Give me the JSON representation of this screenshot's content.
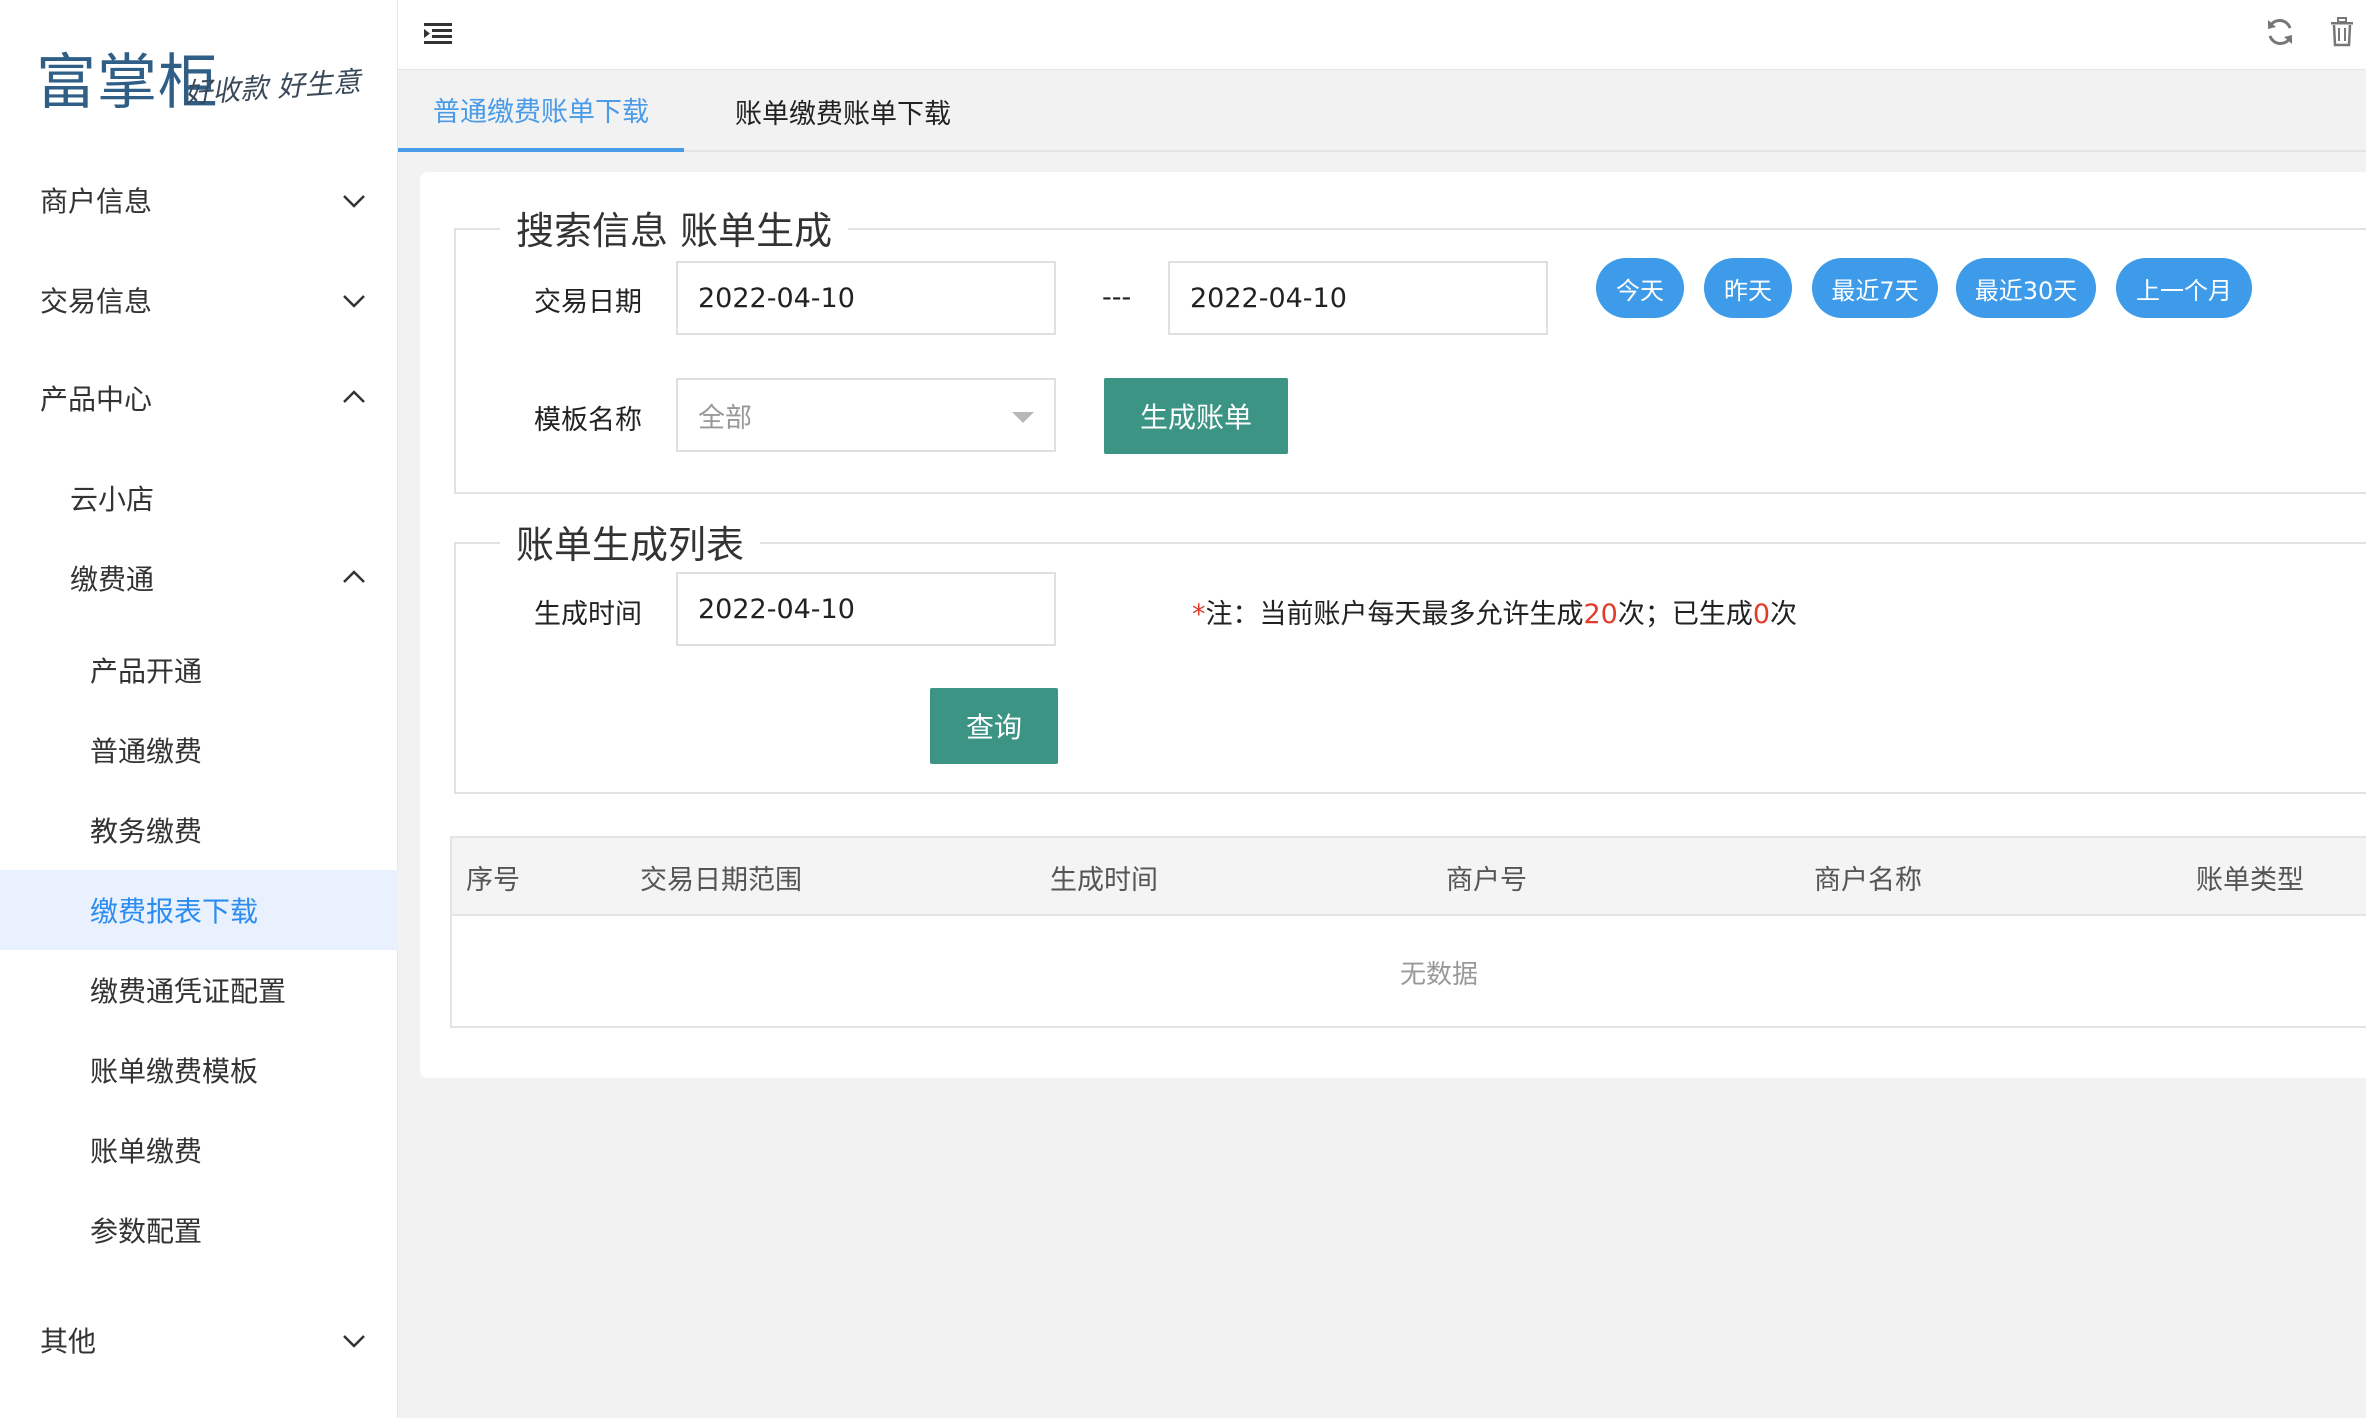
{
  "brand": {
    "name": "富掌柜",
    "slogan": "好收款 好生意"
  },
  "sidebar": {
    "items": [
      {
        "label": "商户信息"
      },
      {
        "label": "交易信息"
      },
      {
        "label": "产品中心"
      },
      {
        "label": "云小店"
      },
      {
        "label": "缴费通"
      },
      {
        "label": "产品开通"
      },
      {
        "label": "普通缴费"
      },
      {
        "label": "教务缴费"
      },
      {
        "label": "缴费报表下载"
      },
      {
        "label": "缴费通凭证配置"
      },
      {
        "label": "账单缴费模板"
      },
      {
        "label": "账单缴费"
      },
      {
        "label": "参数配置"
      },
      {
        "label": "其他"
      }
    ]
  },
  "tabs": [
    {
      "label": "普通缴费账单下载"
    },
    {
      "label": "账单缴费账单下载"
    }
  ],
  "search_section": {
    "legend": "搜索信息 账单生成",
    "trade_date_label": "交易日期",
    "date_start": "2022-04-10",
    "date_separator": "---",
    "date_end": "2022-04-10",
    "quick_ranges": [
      "今天",
      "昨天",
      "最近7天",
      "最近30天",
      "上一个月"
    ],
    "template_label": "模板名称",
    "template_value": "全部",
    "generate_button": "生成账单"
  },
  "list_section": {
    "legend": "账单生成列表",
    "gen_time_label": "生成时间",
    "gen_time_value": "2022-04-10",
    "note_star": "*",
    "note_prefix": "注：当前账户每天最多允许生成",
    "note_max": "20",
    "note_middle": "次；已生成",
    "note_done": "0",
    "note_suffix": "次",
    "query_button": "查询"
  },
  "table": {
    "columns": [
      "序号",
      "交易日期范围",
      "生成时间",
      "商户号",
      "商户名称",
      "账单类型"
    ],
    "empty_text": "无数据"
  },
  "colors": {
    "accent_blue": "#3d9be9",
    "tab_active": "#4a9be8",
    "button_green": "#3b9484",
    "note_red": "#e23b2a",
    "sidebar_active_bg": "#e8f1fd"
  },
  "icons": {
    "menu_toggle": "menu-fold-icon",
    "refresh": "refresh-icon",
    "delete": "trash-icon",
    "expand": "chevron-down-icon",
    "collapse": "chevron-up-icon",
    "select_caret": "caret-down-icon"
  }
}
